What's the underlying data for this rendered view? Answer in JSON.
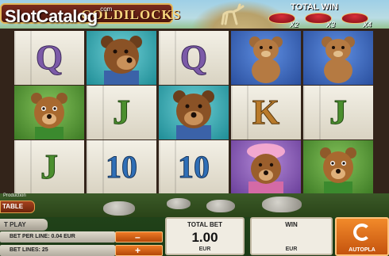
{
  "game": {
    "title": "GOLDILOCKS",
    "watermark": "SlotCatalog",
    "watermark_domain": ".com",
    "production_label": "Production"
  },
  "header": {
    "total_win_label": "TOTAL WIN",
    "multipliers": [
      "X2",
      "X3",
      "X4"
    ]
  },
  "reels": [
    [
      "Q",
      "bear-papa",
      "Q",
      "teddy-bear",
      "teddy-bear"
    ],
    [
      "bear-baby",
      "J",
      "bear-papa",
      "K",
      "J"
    ],
    [
      "J",
      "10",
      "10",
      "bear-mama",
      "bear-baby"
    ]
  ],
  "controls": {
    "paytable_label": "TABLE",
    "autoplay_left_label": "T PLAY",
    "bet_per_line_label": "BET PER LINE: 0.04 EUR",
    "bet_lines_label": "BET LINES: 25",
    "total_bet_label": "TOTAL BET",
    "total_bet_value": "1.00",
    "total_bet_currency": "EUR",
    "win_label": "WIN",
    "win_value": "",
    "win_currency": "EUR",
    "autoplay_label": "AUTOPLA",
    "spin_icon": "spin-icon",
    "minus_icon": "minus-icon",
    "plus_icon": "plus-icon"
  },
  "colors": {
    "accent_orange": "#ee7b26",
    "title_gold": "#f7d67d",
    "title_plaque": "#7a2c1e"
  }
}
